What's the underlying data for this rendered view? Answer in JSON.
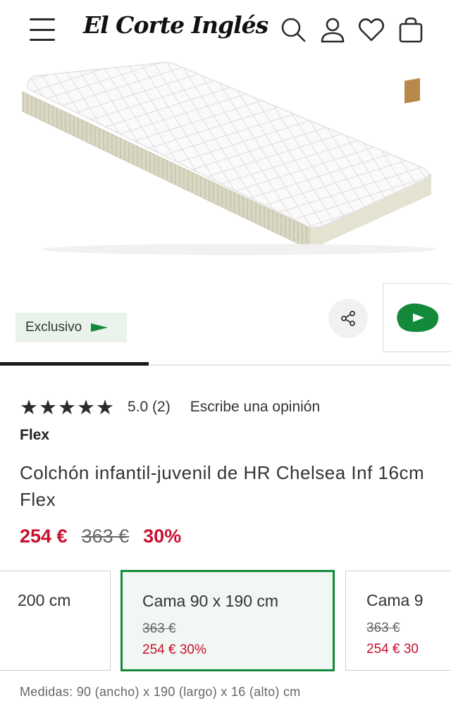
{
  "header": {
    "logo_text": "El Corte Inglés",
    "icons": [
      "menu-icon",
      "search-icon",
      "user-icon",
      "heart-icon",
      "bag-icon"
    ]
  },
  "gallery": {
    "badge_label": "Exclusivo",
    "share_icon": "share-icon",
    "side_tab_icon": "play-arrow-icon",
    "progress": 0.33
  },
  "product": {
    "rating_stars": "★★★★★",
    "rating_value": "5.0 (2)",
    "review_link": "Escribe una opinión",
    "brand": "Flex",
    "title": "Colchón infantil-juvenil de HR Chelsea Inf 16cm Flex",
    "price_now": "254 €",
    "price_old": "363 €",
    "discount": "30%"
  },
  "sizes": [
    {
      "label": "200 cm",
      "old": "",
      "new": ""
    },
    {
      "label": "Cama 90 x 190 cm",
      "old": "363 €",
      "new": "254 €  30%"
    },
    {
      "label": "Cama 9",
      "old": "363 €",
      "new": "254 €  30"
    }
  ],
  "measures": "Medidas: 90 (ancho) x 190 (largo) x 16 (alto) cm",
  "colors": {
    "accent_green": "#138a3a",
    "price_red": "#c8102e"
  }
}
